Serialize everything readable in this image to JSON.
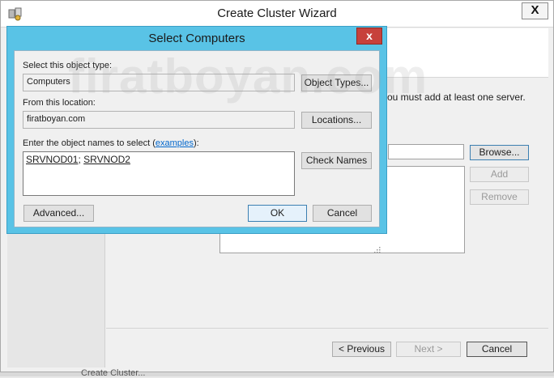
{
  "wizard": {
    "title": "Create Cluster Wizard",
    "close_label": "X",
    "description_fragment": "ou must add at least one server.",
    "browse_label": "Browse...",
    "add_label": "Add",
    "remove_label": "Remove",
    "previous_label": "< Previous",
    "next_label": "Next >",
    "cancel_label": "Cancel",
    "taskbar_fragment": "Create Cluster..."
  },
  "dialog": {
    "title": "Select Computers",
    "close_label": "x",
    "object_type_label": "Select this object type:",
    "object_type_value": "Computers",
    "object_types_button": "Object Types...",
    "location_label": "From this location:",
    "location_value": "firatboyan.com",
    "locations_button": "Locations...",
    "names_label_prefix": "Enter the object names to select (",
    "names_label_link": "examples",
    "names_label_suffix": "):",
    "names": [
      "SRVNOD01",
      "SRVNOD2"
    ],
    "names_separator": "; ",
    "check_names_button": "Check Names",
    "advanced_button": "Advanced...",
    "ok_button": "OK",
    "cancel_button": "Cancel"
  },
  "watermark": "firatboyan.com",
  "colors": {
    "dialog_frame": "#59c3e6",
    "close_button": "#c7413b",
    "link": "#0066cc"
  }
}
